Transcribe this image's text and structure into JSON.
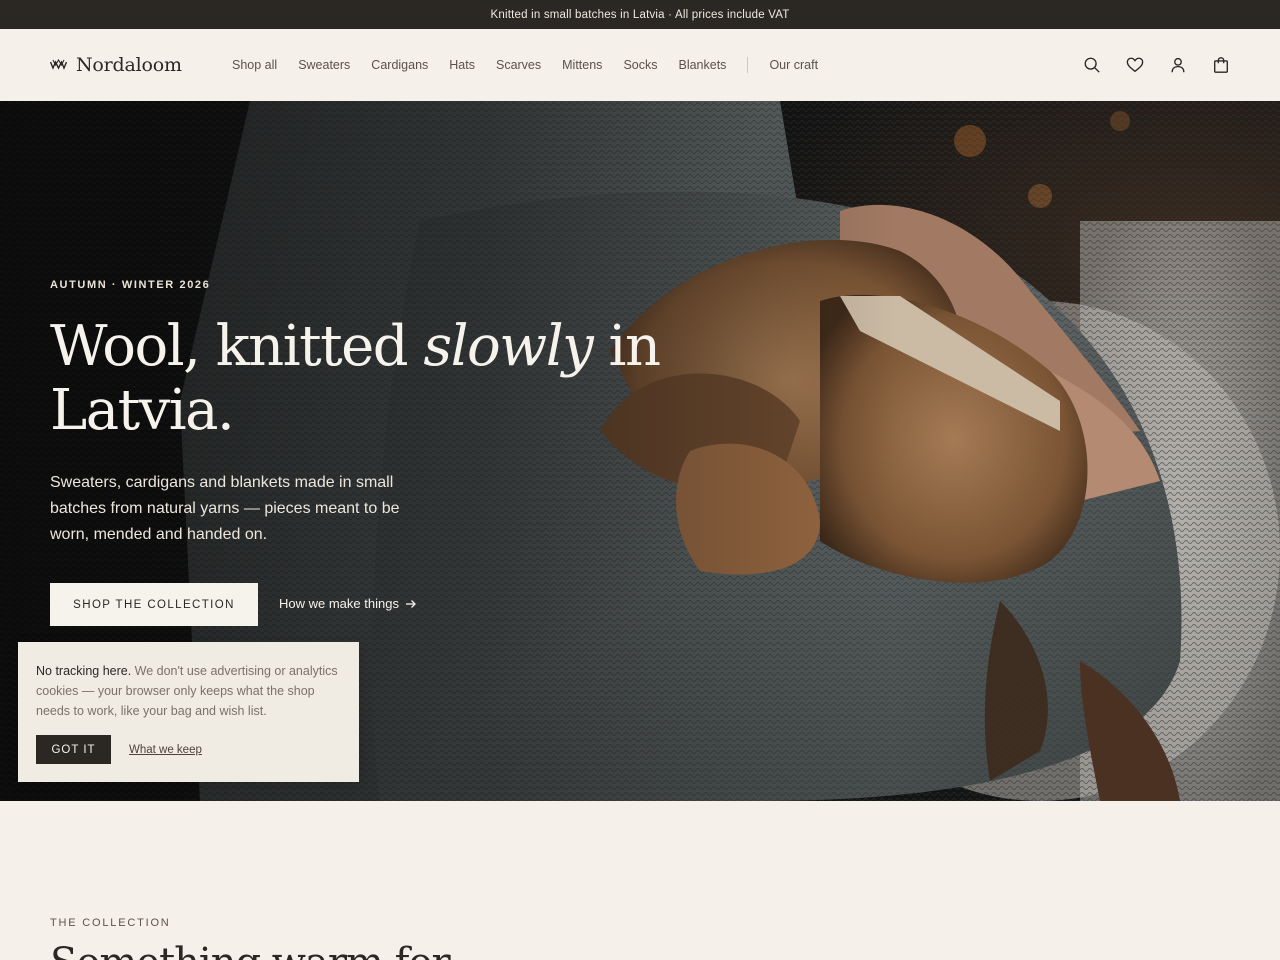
{
  "announcement": "Knitted in small batches in Latvia · All prices include VAT",
  "brand": {
    "name": "Nordaloom",
    "logo_icon": "wave-mark-icon"
  },
  "nav": {
    "items": [
      "Shop all",
      "Sweaters",
      "Cardigans",
      "Hats",
      "Scarves",
      "Mittens",
      "Socks",
      "Blankets"
    ],
    "secondary": "Our craft"
  },
  "header_icons": [
    "search-icon",
    "heart-icon",
    "account-icon",
    "bag-icon"
  ],
  "hero": {
    "eyebrow": "AUTUMN · WINTER 2026",
    "title_part1": "Wool, knitted ",
    "title_emphasis": "slowly",
    "title_part2": " in Latvia.",
    "subtitle": "Sweaters, cardigans and blankets made in small batches from natural yarns — pieces meant to be worn, mended and handed on.",
    "primary_cta": "SHOP THE COLLECTION",
    "secondary_cta": "How we make things"
  },
  "cookie": {
    "lead": "No tracking here.",
    "body": " We don't use advertising or analytics cookies — your browser only keeps what the shop needs to work, like your bag and wish list.",
    "accept": "GOT IT",
    "link": "What we keep"
  },
  "collection": {
    "eyebrow": "THE COLLECTION",
    "title": "Something warm for..."
  },
  "colors": {
    "announcement_bg": "#2b2723",
    "page_bg": "#f5f1ea",
    "text_dark": "#2b2722",
    "hero_text": "#f6f2ec"
  }
}
